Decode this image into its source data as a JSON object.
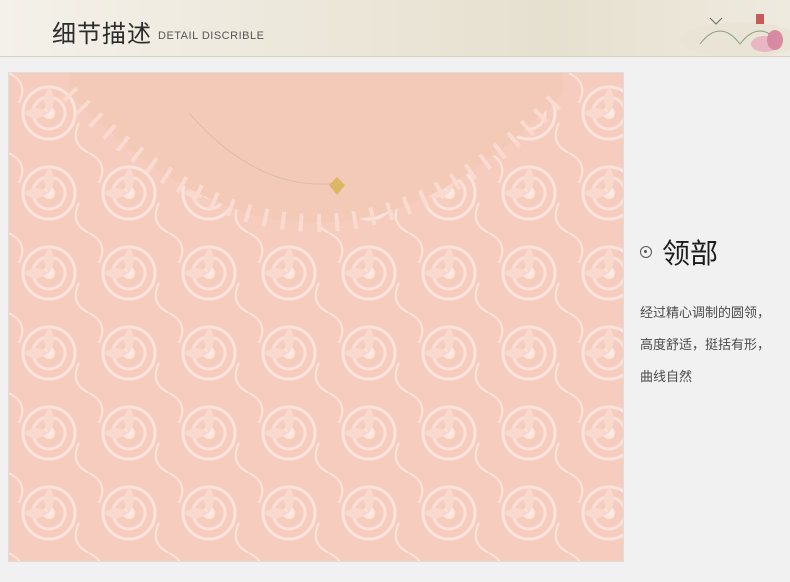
{
  "banner": {
    "title": "细节描述",
    "subtitle": "DETAIL DISCRIBLE",
    "decoration_icon": "lotus-ink-painting-icon"
  },
  "photo": {
    "icon": "pink-lace-neckline-photo"
  },
  "detail": {
    "bullet_icon": "circle-dot-icon",
    "title": "领部",
    "lines": [
      "经过精心调制的圆领，",
      "高度舒适，挺括有形，",
      "曲线自然"
    ]
  },
  "colors": {
    "lace": "#f6c9bb",
    "lace_light": "#fbe0d6",
    "skin": "#f3c7b4",
    "text_dark": "#1d1d1d",
    "text_body": "#4a4a4a"
  }
}
